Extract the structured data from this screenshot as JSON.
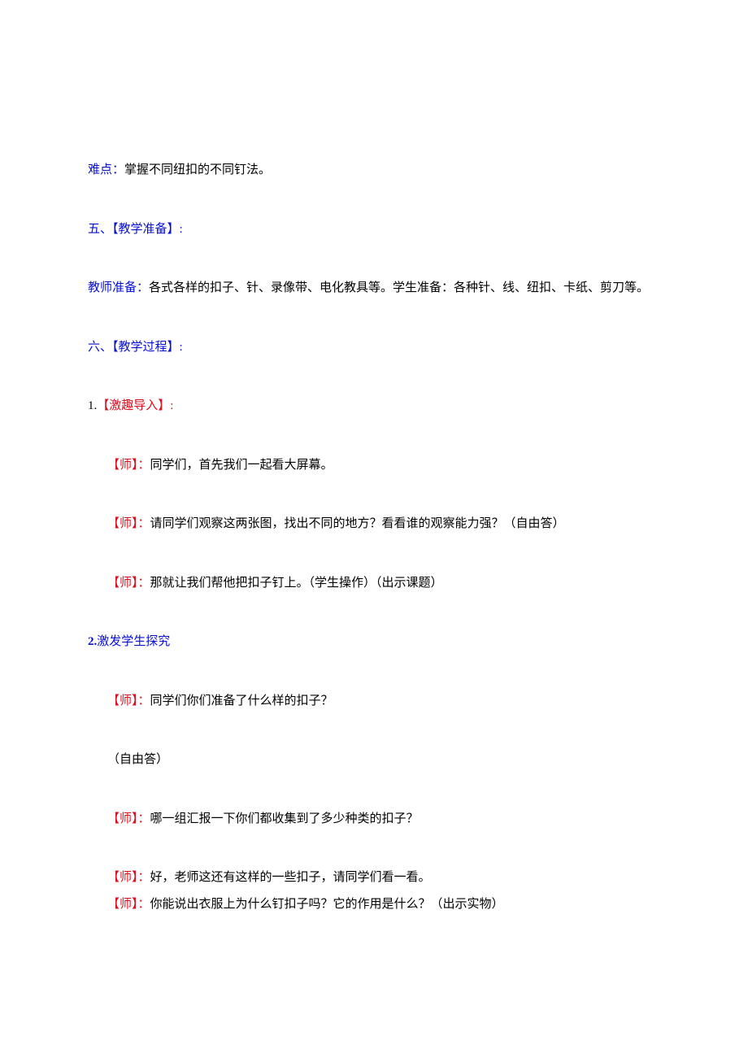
{
  "p1": {
    "label": "难点：",
    "text": "掌握不同纽扣的不同钉法。"
  },
  "p2": {
    "label": "五、【教学准备】:"
  },
  "p3": {
    "label": "教师准备：",
    "text": "各式各样的扣子、针、录像带、电化教具等。学生准备：各种针、线、纽扣、卡纸、剪刀等。"
  },
  "p4": {
    "label": "六、【教学过程】:"
  },
  "p5": {
    "num": "1.",
    "label": "【激趣导入】:"
  },
  "p6": {
    "label": "【师】：",
    "text": "同学们，首先我们一起看大屏幕。"
  },
  "p7": {
    "label": "【师】：",
    "text": "请同学们观察这两张图，找出不同的地方？看看谁的观察能力强？（自由答）"
  },
  "p8": {
    "label": "【师】：",
    "text": "那就让我们帮他把扣子钉上。（学生操作）（出示课题）"
  },
  "p9": {
    "num": "2.",
    "label": "激发学生探究"
  },
  "p10": {
    "label": "【师】：",
    "text": "同学们你们准备了什么样的扣子？"
  },
  "p11": {
    "text": "（自由答）"
  },
  "p12": {
    "label": "【师】：",
    "text": "哪一组汇报一下你们都收集到了多少种类的扣子？"
  },
  "p13": {
    "label": "【师】：",
    "text": "好，老师这还有这样的一些扣子，请同学们看一看。"
  },
  "p14": {
    "label": "【师】：",
    "text": "你能说出衣服上为什么钉扣子吗？它的作用是什么？（出示实物）"
  }
}
